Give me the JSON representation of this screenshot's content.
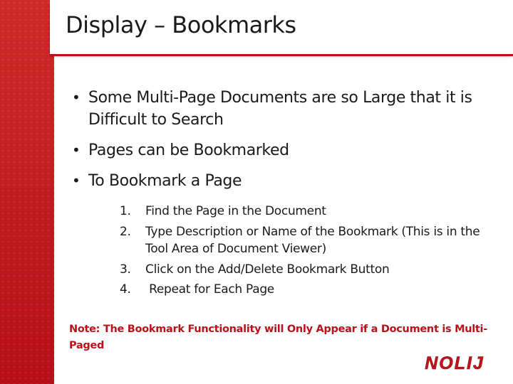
{
  "slide": {
    "title": "Display – Bookmarks",
    "bullets": [
      {
        "text": "Some Multi-Page Documents are so Large that it is Difficult to Search"
      },
      {
        "text": "Pages can be Bookmarked"
      },
      {
        "text": "To Bookmark a Page"
      }
    ],
    "bullet_symbol": "•",
    "steps": [
      {
        "num": "1.",
        "text": "Find the Page in the Document"
      },
      {
        "num": "2.",
        "text": "Type Description or Name of the Bookmark (This is in the Tool Area of Document Viewer)"
      },
      {
        "num": "3.",
        "text": "Click on the Add/Delete Bookmark Button"
      },
      {
        "num": "4.",
        "text": " Repeat for Each Page"
      }
    ],
    "note": "Note: The Bookmark Functionality will Only Appear if a Document is Multi-Paged",
    "logo_text": "NOLIJ"
  },
  "colors": {
    "accent_red": "#c4141b",
    "note_red": "#b8121a",
    "text": "#1a1a1a"
  }
}
